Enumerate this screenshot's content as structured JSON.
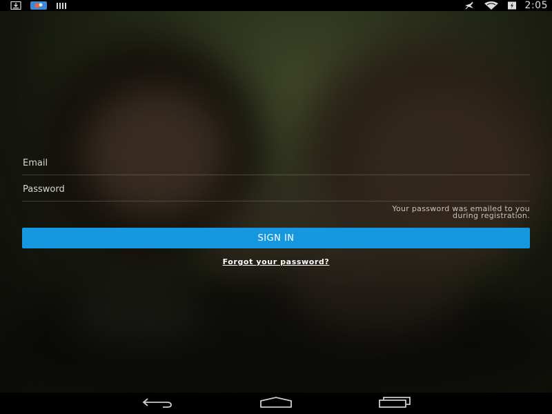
{
  "status_bar": {
    "time": "2:05",
    "icons": [
      "download-icon",
      "app-notification-icon",
      "signal-bars-icon",
      "airplane-off-icon",
      "wifi-icon",
      "battery-icon"
    ]
  },
  "login": {
    "email_placeholder": "Email",
    "password_placeholder": "Password",
    "password_hint_line1": "Your password was emailed to you",
    "password_hint_line2": "during registration.",
    "signin_label": "SIGN IN",
    "forgot_label": "Forgot your password?"
  },
  "colors": {
    "accent": "#1698e0"
  },
  "nav_bar": {
    "icons": [
      "back-icon",
      "home-icon",
      "recent-apps-icon"
    ]
  }
}
